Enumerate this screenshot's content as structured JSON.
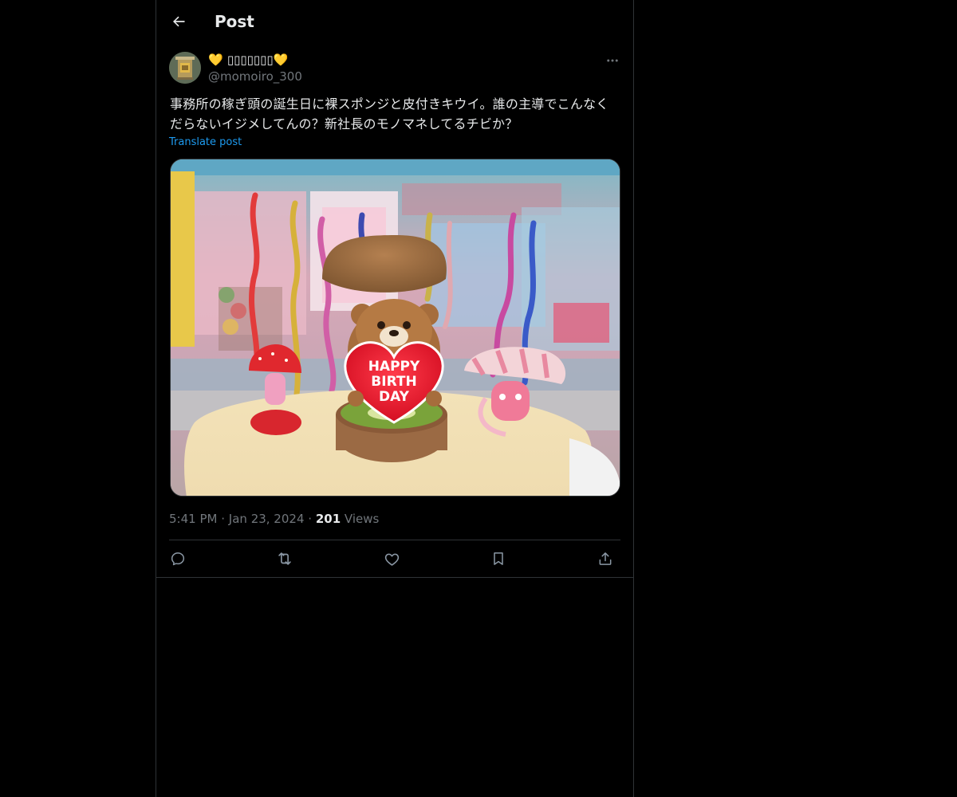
{
  "header": {
    "title": "Post",
    "back_icon": "arrow-left-icon"
  },
  "author": {
    "heart_left": "💛",
    "display_name": " ▯▯▯▯▯▯▯",
    "heart_right": "💛",
    "handle": "@momoiro_300",
    "avatar_icon": "avatar-image"
  },
  "post": {
    "text": "事務所の稼ぎ頭の誕生日に裸スポンジと皮付きキウイ。誰の主導でこんなくだらないイジメしてんの？新社長のモノマネしてるチビか？",
    "translate_label": "Translate post",
    "media": {
      "heart_text_line1": "HAPPY",
      "heart_text_line2": "BIRTH",
      "heart_text_line3": "DAY"
    }
  },
  "meta": {
    "time": "5:41 PM",
    "separator": "·",
    "date": "Jan 23, 2024",
    "views_count": "201",
    "views_label": "Views"
  },
  "actions": {
    "reply_icon": "reply-icon",
    "repost_icon": "repost-icon",
    "like_icon": "like-icon",
    "bookmark_icon": "bookmark-icon",
    "share_icon": "share-icon"
  },
  "colors": {
    "background": "#000000",
    "text_primary": "#e7e9ea",
    "text_secondary": "#71767b",
    "link": "#1d9bf0",
    "border": "#2f3336"
  }
}
